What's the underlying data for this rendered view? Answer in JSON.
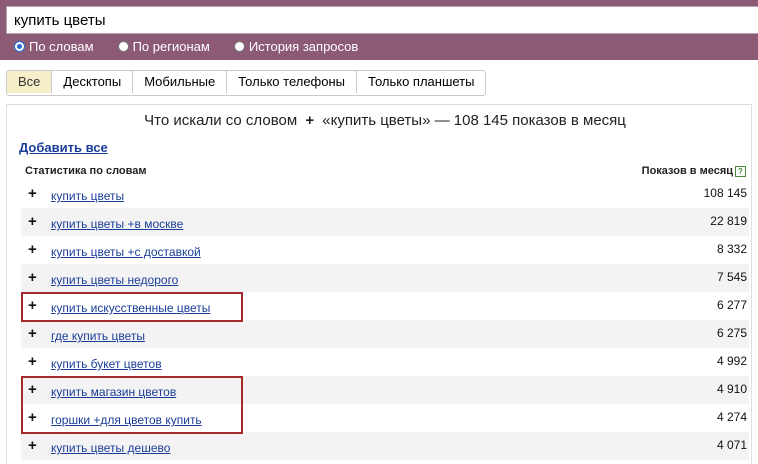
{
  "search": {
    "value": "купить цветы"
  },
  "radios": [
    {
      "label": "По словам",
      "checked": true
    },
    {
      "label": "По регионам",
      "checked": false
    },
    {
      "label": "История запросов",
      "checked": false
    }
  ],
  "tabs": [
    {
      "label": "Все",
      "active": true
    },
    {
      "label": "Десктопы",
      "active": false
    },
    {
      "label": "Мобильные",
      "active": false
    },
    {
      "label": "Только телефоны",
      "active": false
    },
    {
      "label": "Только планшеты",
      "active": false
    }
  ],
  "heading": {
    "prefix": "Что искали со словом",
    "plus": "+",
    "suffix": "«купить цветы» — 108 145 показов в месяц"
  },
  "add_all": "Добавить все",
  "table": {
    "col_left": "Статистика по словам",
    "col_right": "Показов в месяц",
    "help": "?",
    "rows": [
      {
        "phrase": "купить цветы",
        "count": "108 145"
      },
      {
        "phrase": "купить цветы +в москве",
        "count": "22 819"
      },
      {
        "phrase": "купить цветы +с доставкой",
        "count": "8 332"
      },
      {
        "phrase": "купить цветы недорого",
        "count": "7 545"
      },
      {
        "phrase": "купить искусственные цветы",
        "count": "6 277"
      },
      {
        "phrase": "где купить цветы",
        "count": "6 275"
      },
      {
        "phrase": "купить букет цветов",
        "count": "4 992"
      },
      {
        "phrase": "купить магазин цветов",
        "count": "4 910"
      },
      {
        "phrase": "горшки +для цветов купить",
        "count": "4 274"
      },
      {
        "phrase": "купить цветы дешево",
        "count": "4 071"
      }
    ]
  },
  "colors": {
    "topbar": "#8c5a74",
    "link": "#1a3d99",
    "highlight": "#a52a2a",
    "active_tab": "#f6efc9"
  },
  "icons": {
    "add_row": "plus-icon",
    "help": "help-icon"
  }
}
